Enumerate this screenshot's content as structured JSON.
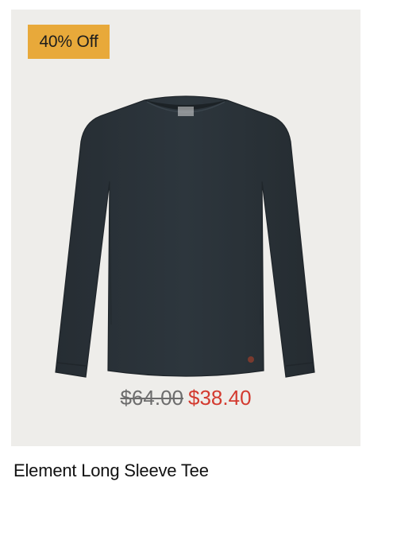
{
  "product": {
    "discount_badge": "40% Off",
    "price_original": "$64.00",
    "price_sale": "$38.40",
    "name": "Element Long Sleeve Tee",
    "image_icon": "long-sleeve-shirt-icon"
  },
  "colors": {
    "badge_bg": "#e8a93a",
    "sale_price": "#d33a2f",
    "original_price": "#6d6d6d",
    "shirt": "#2b333a",
    "panel_bg": "#eeedea"
  }
}
